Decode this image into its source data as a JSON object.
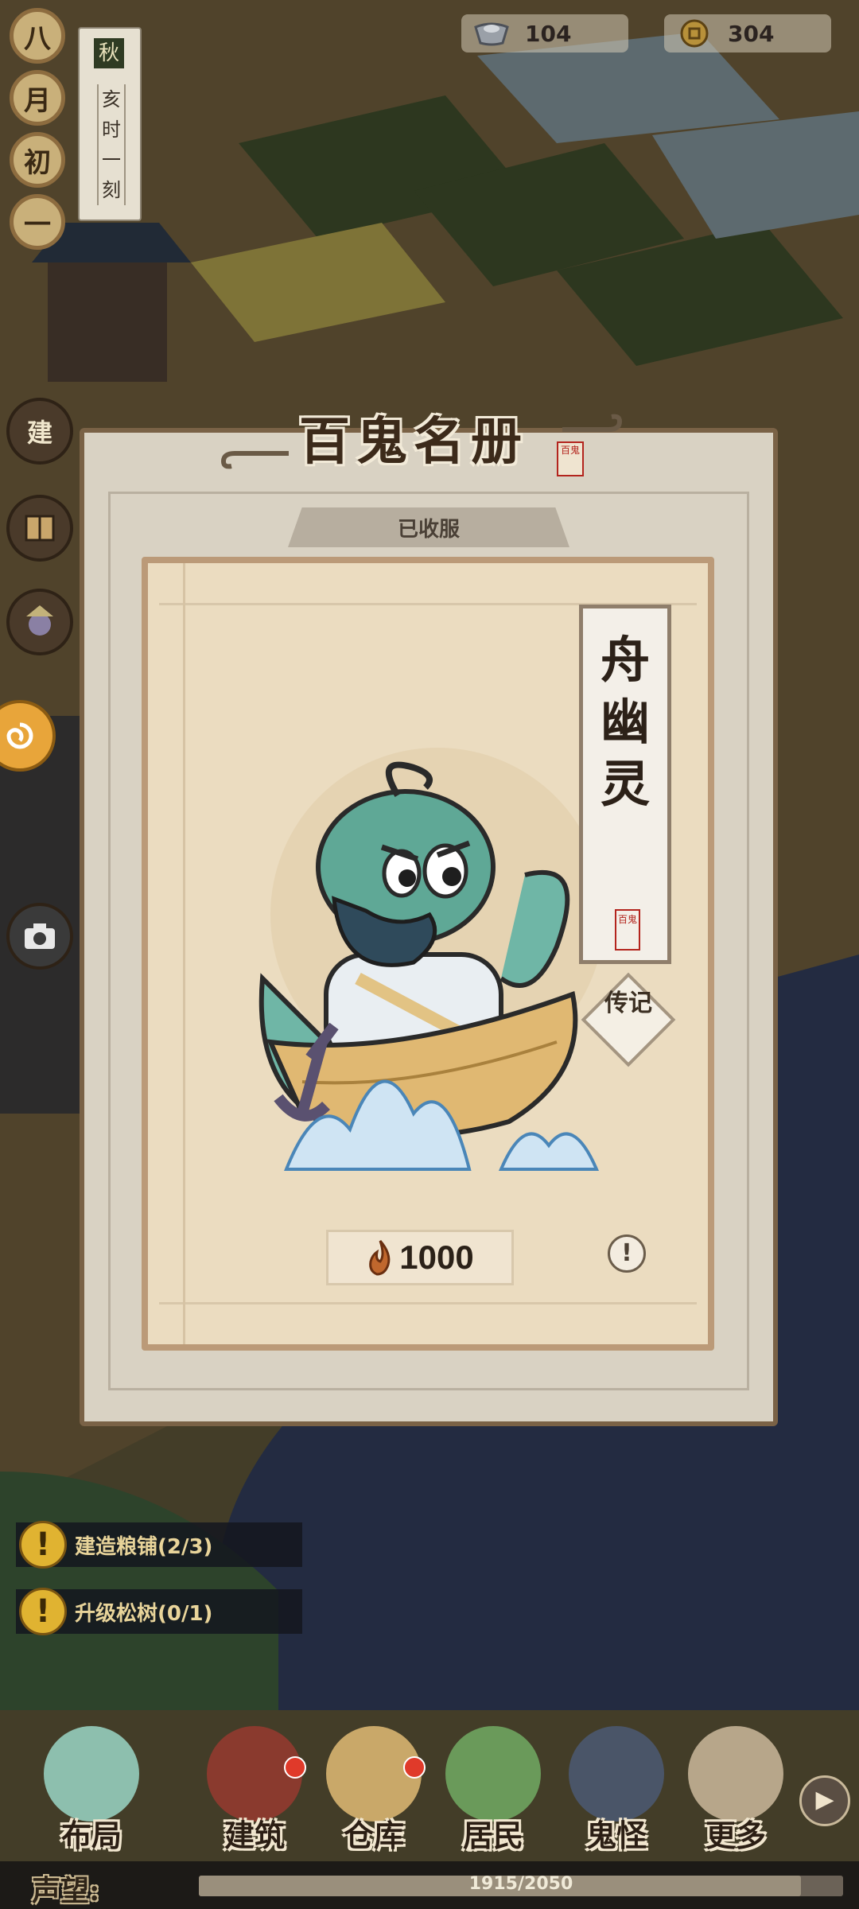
{
  "currency": {
    "silver": "104",
    "coin": "304"
  },
  "calendar": {
    "month_chars": [
      "八",
      "月",
      "初",
      "一"
    ],
    "season": "秋",
    "time_chars": [
      "亥",
      "时",
      "一",
      "刻"
    ]
  },
  "side_buttons": {
    "build": "建"
  },
  "dialog": {
    "title": "百鬼名册",
    "seal": "百鬼",
    "status_tab": "已收服",
    "ghost_name": "舟幽灵",
    "name_seal": "百鬼",
    "bio_button": "传记",
    "cost": "1000",
    "info": "!"
  },
  "quests": [
    {
      "label": "建造粮铺(2/3)"
    },
    {
      "label": "升级松树(0/1)"
    }
  ],
  "nav": {
    "items": [
      {
        "label": "布局"
      },
      {
        "label": "建筑"
      },
      {
        "label": "仓库"
      },
      {
        "label": "居民"
      },
      {
        "label": "鬼怪"
      },
      {
        "label": "更多"
      }
    ]
  },
  "reputation": {
    "label": "声望:",
    "value": "1915/2050",
    "progress": 0.934
  },
  "colors": {
    "dialog_bg": "#d9d2c3",
    "card_bg": "#ebdcc0",
    "accent_red": "#e03a2a",
    "quest_icon": "#e0b331"
  }
}
